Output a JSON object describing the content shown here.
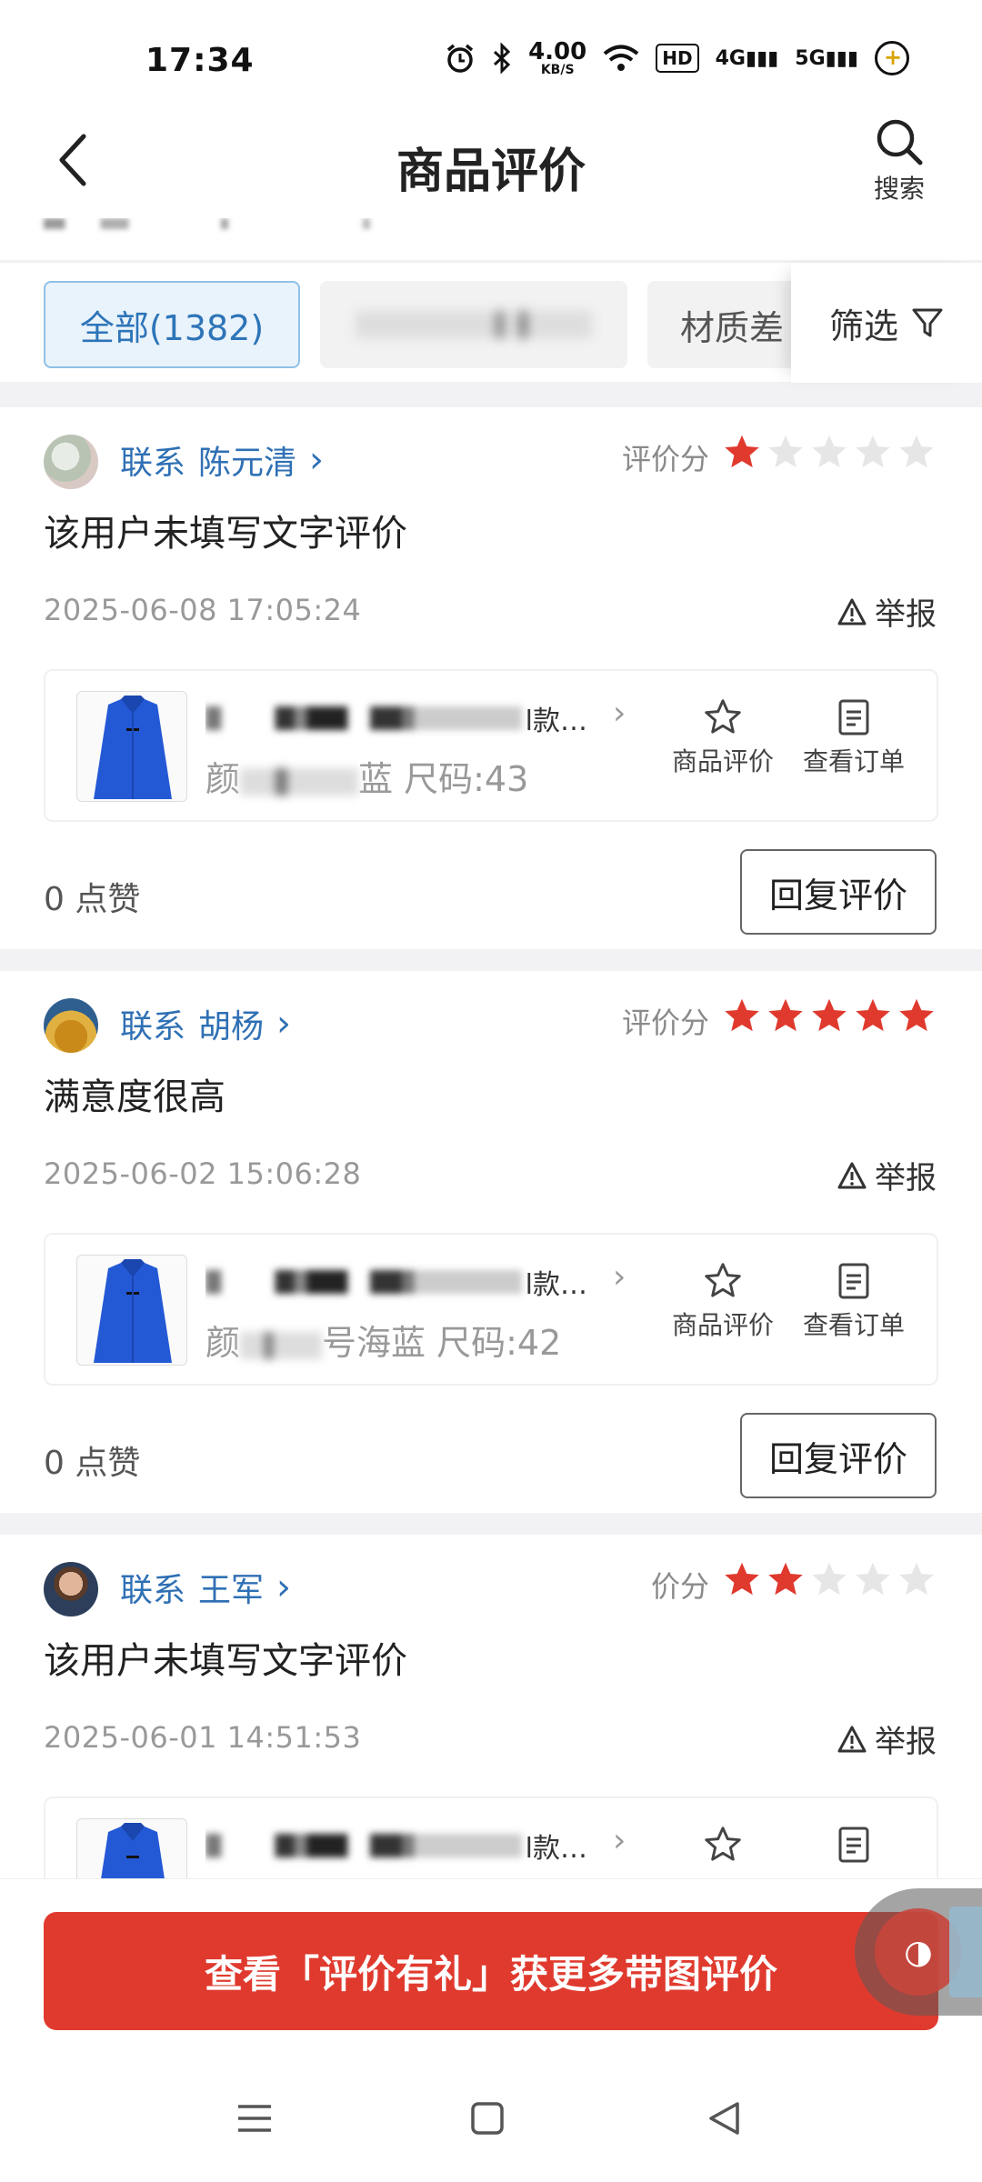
{
  "status_bar": {
    "time": "17:34",
    "net_speed": "4.00",
    "net_unit": "KB/S",
    "hd": "HD",
    "sig1": "4G",
    "sig2": "5G"
  },
  "header": {
    "title": "商品评价",
    "search_label": "搜索"
  },
  "filters": {
    "all_label": "全部(1382)",
    "material_label": "材质差",
    "filter_label": "筛选"
  },
  "colors": {
    "accent_blue": "#2f70b4",
    "star_on": "#e03a2e",
    "star_off": "#e6e6e6",
    "promo_red": "#e03a2e"
  },
  "reviews": [
    {
      "contact_prefix": "联系",
      "name": "陈元清",
      "score_label": "评价分",
      "stars": 1,
      "text": "该用户未填写文字评价",
      "date": "2025-06-08 17:05:24",
      "report_label": "举报",
      "product_name_end": "l款…",
      "spec_prefix": "颜",
      "spec_visible": "蓝",
      "size": "尺码:43",
      "action_eval": "商品评价",
      "action_order": "查看订单",
      "likes": "0 点赞",
      "reply_label": "回复评价"
    },
    {
      "contact_prefix": "联系",
      "name": "胡杨",
      "score_label": "评价分",
      "stars": 5,
      "text": "满意度很高",
      "date": "2025-06-02 15:06:28",
      "report_label": "举报",
      "product_name_end": "l款…",
      "spec_prefix": "颜",
      "spec_visible": "号海蓝",
      "size": "尺码:42",
      "action_eval": "商品评价",
      "action_order": "查看订单",
      "likes": "0 点赞",
      "reply_label": "回复评价"
    },
    {
      "contact_prefix": "联系",
      "name": "王军",
      "score_label": "价分",
      "stars": 2,
      "text": "该用户未填写文字评价",
      "date": "2025-06-01 14:51:53",
      "report_label": "举报",
      "product_name_end": "l款…",
      "spec_prefix": "",
      "spec_visible": "",
      "size": "",
      "action_eval": "",
      "action_order": "",
      "likes": "",
      "reply_label": ""
    }
  ],
  "promo": {
    "label": "查看「评价有礼」获更多带图评价"
  },
  "icons": {
    "back": "back-arrow-icon",
    "search": "search-icon",
    "filter": "funnel-icon",
    "star": "star-icon",
    "report": "warning-icon",
    "order": "document-icon"
  }
}
